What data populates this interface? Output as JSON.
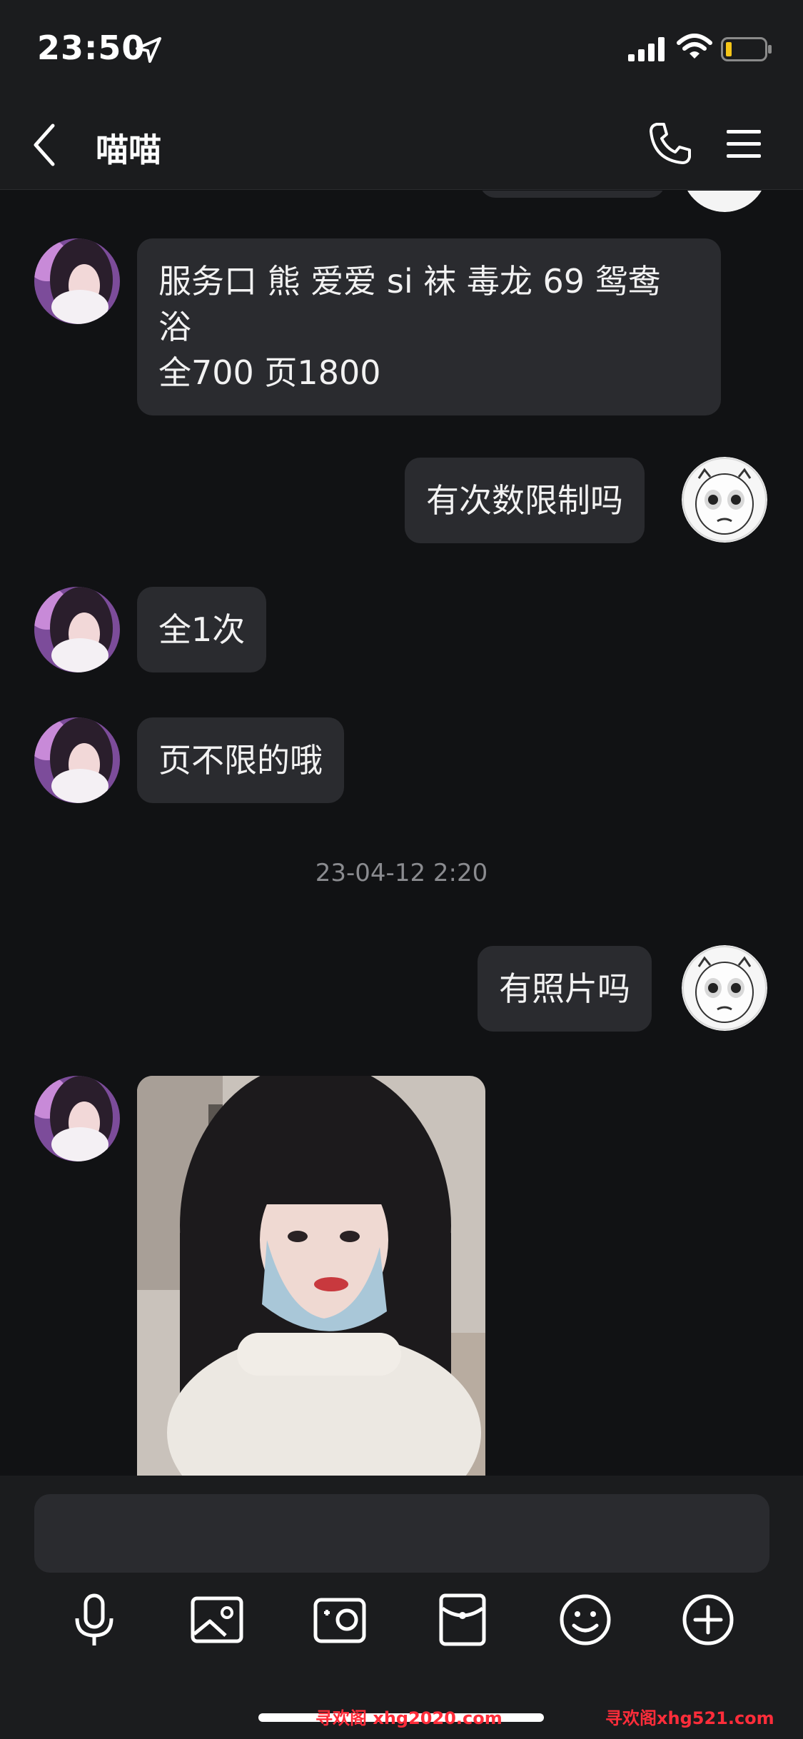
{
  "status_bar": {
    "time": "23:50"
  },
  "header": {
    "title": "喵喵"
  },
  "messages": [
    {
      "side": "left",
      "text_lines": [
        "服务口 熊 爱爱 si 袜 毒龙 69 鸳鸯",
        "浴",
        "全700 页1800"
      ]
    },
    {
      "side": "right",
      "text": "有次数限制吗"
    },
    {
      "side": "left",
      "text": "全1次"
    },
    {
      "side": "left",
      "text": "页不限的哦"
    },
    {
      "type": "timestamp",
      "text": "23-04-12 2:20"
    },
    {
      "side": "right",
      "text": "有照片吗"
    },
    {
      "side": "left",
      "type": "image"
    }
  ],
  "toolbar": {
    "icons": [
      "microphone-icon",
      "image-icon",
      "camera-icon",
      "red-packet-icon",
      "emoji-icon",
      "plus-icon"
    ]
  },
  "watermarks": [
    "寻欢阁 xhg2020.com",
    "寻欢阁xhg521.com"
  ],
  "colors": {
    "background": "#111214",
    "bar": "#1b1c1e",
    "bubble": "#2a2b2f",
    "watermark": "#ff2d3a"
  }
}
